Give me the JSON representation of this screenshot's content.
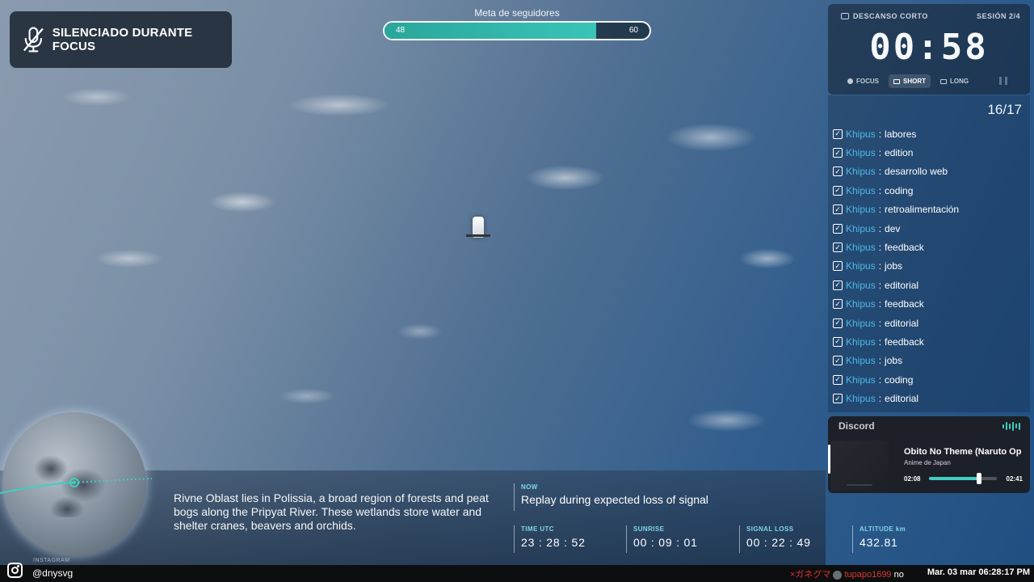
{
  "mute_badge": {
    "label": "SILENCIADO DURANTE FOCUS",
    "icon": "mic-off-icon"
  },
  "follower_goal": {
    "title": "Meta de seguidores",
    "current": 48,
    "target": 60,
    "fill_fraction": 0.8,
    "color": "#2aa69a"
  },
  "pomodoro": {
    "mode": "DESCANSO CORTO",
    "session": "SESIÓN 2/4",
    "timer": "00:58",
    "tabs": [
      {
        "label": "FOCUS",
        "active": false
      },
      {
        "label": "SHORT",
        "active": true
      },
      {
        "label": "LONG",
        "active": false
      }
    ]
  },
  "tasks": {
    "count": "16/17",
    "prefix": "Khipus",
    "prefix_color": "#4fb8e8",
    "items": [
      {
        "name": "labores",
        "checked": true
      },
      {
        "name": "edition",
        "checked": true
      },
      {
        "name": "desarrollo web",
        "checked": true
      },
      {
        "name": "coding",
        "checked": true
      },
      {
        "name": "retroalimentación",
        "checked": true
      },
      {
        "name": "dev",
        "checked": true
      },
      {
        "name": "feedback",
        "checked": true
      },
      {
        "name": "jobs",
        "checked": true
      },
      {
        "name": "editorial",
        "checked": true
      },
      {
        "name": "feedback",
        "checked": true
      },
      {
        "name": "editorial",
        "checked": true
      },
      {
        "name": "feedback",
        "checked": true
      },
      {
        "name": "jobs",
        "checked": true
      },
      {
        "name": "coding",
        "checked": true
      },
      {
        "name": "editorial",
        "checked": true
      }
    ]
  },
  "discord": {
    "title": "Discord",
    "track": "Obito No Theme (Naruto Opening)",
    "artist": "Anime de Japan",
    "elapsed": "02:08",
    "total": "02:41",
    "progress_fraction": 0.74,
    "accent_color": "#3ecfc0"
  },
  "iss": {
    "location_text": "Rivne Oblast lies in Polissia, a broad region of forests and peat bogs along the Pripyat River. These wetlands store water and shelter cranes, beavers and orchids.",
    "now_label": "NOW",
    "now_text": "Replay during expected loss of signal",
    "stats": [
      {
        "label": "TIME UTC",
        "value": "23 : 28 : 52"
      },
      {
        "label": "SUNRISE",
        "value": "00 : 09 : 01"
      },
      {
        "label": "SIGNAL LOSS",
        "value": "00 : 22 : 49"
      },
      {
        "label": "ALTITUDE km",
        "value": "432.81"
      }
    ]
  },
  "bottom_bar": {
    "instagram_label": "INSTAGRAM",
    "instagram_handle": "@dnysvg",
    "chat_user1": "×ガネグマ",
    "chat_user2": "tupapo1699",
    "chat_message": "no",
    "clock": "Mar. 03 mar 06:28:17 PM"
  }
}
